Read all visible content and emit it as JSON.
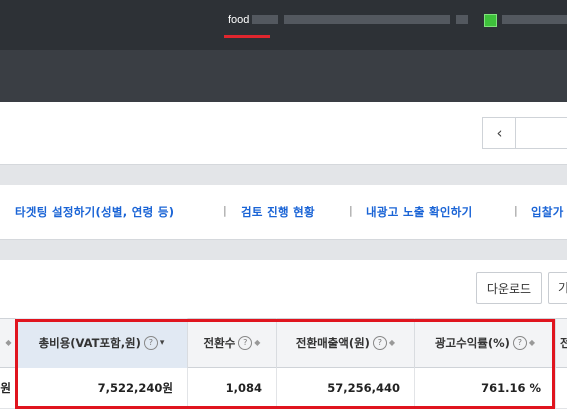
{
  "header": {
    "active_tab": "food",
    "accent_color": "#e0262e"
  },
  "pager": {
    "prev_icon": "‹"
  },
  "links": [
    {
      "label": "타겟팅 설정하기(성별, 연령 등)"
    },
    {
      "label": "검토 진행 현황"
    },
    {
      "label": "내광고 노출 확인하기"
    },
    {
      "label": "입찰가"
    }
  ],
  "separator": "|",
  "toolbar": {
    "download_label": "다운로드",
    "more_label": "기"
  },
  "table": {
    "columns": [
      {
        "label": "총비용(VAT포함,원)"
      },
      {
        "label": "전환수"
      },
      {
        "label": "전환매출액(원)"
      },
      {
        "label": "광고수익률(%)"
      },
      {
        "label": "전"
      }
    ],
    "help_icon": "?",
    "sort_icon": "◆",
    "sort_down_icon": "▾",
    "row": {
      "prev_cell_tail": "원",
      "cost": "7,522,240원",
      "conversions": "1,084",
      "revenue": "57,256,440",
      "roas": "761.16 %"
    }
  }
}
